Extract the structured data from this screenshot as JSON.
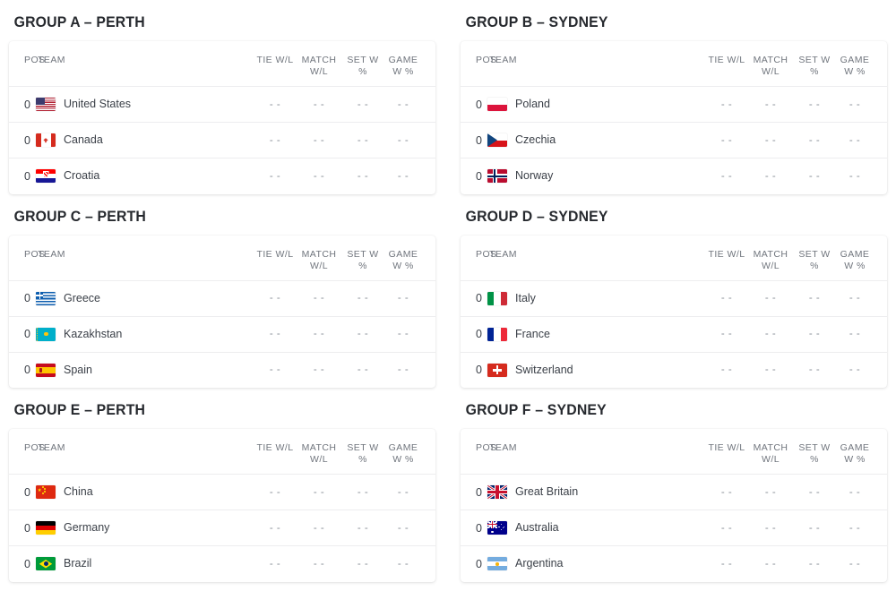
{
  "columns": {
    "pos": "POS",
    "team": "TEAM",
    "tie_wl": "TIE W/L",
    "match_wl": "MATCH W/L",
    "set_w_pct": "SET W %",
    "game_w_pct": "GAME W %"
  },
  "empty_value": "- -",
  "groups": [
    {
      "title": "GROUP A – PERTH",
      "letter": "A",
      "city": "Perth",
      "rows": [
        {
          "pos": "0",
          "team": "United States",
          "flag": "us-flag-icon",
          "tie_wl": "- -",
          "match_wl": "- -",
          "set_w_pct": "- -",
          "game_w_pct": "- -"
        },
        {
          "pos": "0",
          "team": "Canada",
          "flag": "ca-flag-icon",
          "tie_wl": "- -",
          "match_wl": "- -",
          "set_w_pct": "- -",
          "game_w_pct": "- -"
        },
        {
          "pos": "0",
          "team": "Croatia",
          "flag": "hr-flag-icon",
          "tie_wl": "- -",
          "match_wl": "- -",
          "set_w_pct": "- -",
          "game_w_pct": "- -"
        }
      ]
    },
    {
      "title": "GROUP B – SYDNEY",
      "letter": "B",
      "city": "Sydney",
      "rows": [
        {
          "pos": "0",
          "team": "Poland",
          "flag": "pl-flag-icon",
          "tie_wl": "- -",
          "match_wl": "- -",
          "set_w_pct": "- -",
          "game_w_pct": "- -"
        },
        {
          "pos": "0",
          "team": "Czechia",
          "flag": "cz-flag-icon",
          "tie_wl": "- -",
          "match_wl": "- -",
          "set_w_pct": "- -",
          "game_w_pct": "- -"
        },
        {
          "pos": "0",
          "team": "Norway",
          "flag": "no-flag-icon",
          "tie_wl": "- -",
          "match_wl": "- -",
          "set_w_pct": "- -",
          "game_w_pct": "- -"
        }
      ]
    },
    {
      "title": "GROUP C – PERTH",
      "letter": "C",
      "city": "Perth",
      "rows": [
        {
          "pos": "0",
          "team": "Greece",
          "flag": "gr-flag-icon",
          "tie_wl": "- -",
          "match_wl": "- -",
          "set_w_pct": "- -",
          "game_w_pct": "- -"
        },
        {
          "pos": "0",
          "team": "Kazakhstan",
          "flag": "kz-flag-icon",
          "tie_wl": "- -",
          "match_wl": "- -",
          "set_w_pct": "- -",
          "game_w_pct": "- -"
        },
        {
          "pos": "0",
          "team": "Spain",
          "flag": "es-flag-icon",
          "tie_wl": "- -",
          "match_wl": "- -",
          "set_w_pct": "- -",
          "game_w_pct": "- -"
        }
      ]
    },
    {
      "title": "GROUP D – SYDNEY",
      "letter": "D",
      "city": "Sydney",
      "rows": [
        {
          "pos": "0",
          "team": "Italy",
          "flag": "it-flag-icon",
          "tie_wl": "- -",
          "match_wl": "- -",
          "set_w_pct": "- -",
          "game_w_pct": "- -"
        },
        {
          "pos": "0",
          "team": "France",
          "flag": "fr-flag-icon",
          "tie_wl": "- -",
          "match_wl": "- -",
          "set_w_pct": "- -",
          "game_w_pct": "- -"
        },
        {
          "pos": "0",
          "team": "Switzerland",
          "flag": "ch-flag-icon",
          "tie_wl": "- -",
          "match_wl": "- -",
          "set_w_pct": "- -",
          "game_w_pct": "- -"
        }
      ]
    },
    {
      "title": "GROUP E – PERTH",
      "letter": "E",
      "city": "Perth",
      "rows": [
        {
          "pos": "0",
          "team": "China",
          "flag": "cn-flag-icon",
          "tie_wl": "- -",
          "match_wl": "- -",
          "set_w_pct": "- -",
          "game_w_pct": "- -"
        },
        {
          "pos": "0",
          "team": "Germany",
          "flag": "de-flag-icon",
          "tie_wl": "- -",
          "match_wl": "- -",
          "set_w_pct": "- -",
          "game_w_pct": "- -"
        },
        {
          "pos": "0",
          "team": "Brazil",
          "flag": "br-flag-icon",
          "tie_wl": "- -",
          "match_wl": "- -",
          "set_w_pct": "- -",
          "game_w_pct": "- -"
        }
      ]
    },
    {
      "title": "GROUP F – SYDNEY",
      "letter": "F",
      "city": "Sydney",
      "rows": [
        {
          "pos": "0",
          "team": "Great Britain",
          "flag": "gb-flag-icon",
          "tie_wl": "- -",
          "match_wl": "- -",
          "set_w_pct": "- -",
          "game_w_pct": "- -"
        },
        {
          "pos": "0",
          "team": "Australia",
          "flag": "au-flag-icon",
          "tie_wl": "- -",
          "match_wl": "- -",
          "set_w_pct": "- -",
          "game_w_pct": "- -"
        },
        {
          "pos": "0",
          "team": "Argentina",
          "flag": "ar-flag-icon",
          "tie_wl": "- -",
          "match_wl": "- -",
          "set_w_pct": "- -",
          "game_w_pct": "- -"
        }
      ]
    }
  ],
  "colors": {
    "card_background": "#ffffff",
    "page_background": "#ffffff",
    "title_text": "#26292e",
    "header_text": "#70757d",
    "team_text": "#3b4048",
    "stat_text": "#8b9099",
    "divider": "#ededef"
  }
}
